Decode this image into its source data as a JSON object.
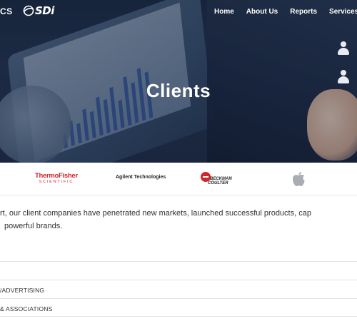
{
  "header": {
    "brand_fragment": "CS",
    "logo_text": "SDi",
    "nav": [
      "Home",
      "About Us",
      "Reports",
      "Services"
    ]
  },
  "hero": {
    "title": "Clients"
  },
  "client_logos": {
    "thermo_line1": "ThermoFisher",
    "thermo_line2": "SCIENTIFIC",
    "agilent": "Agilent Technologies",
    "beckman_line1": "BECKMAN",
    "beckman_line2": "COULTER",
    "apple_icon": "apple-icon"
  },
  "intro": {
    "line1": "rt, our client companies have penetrated new markets, launched successful products, cap",
    "line2": "powerful brands."
  },
  "categories": [
    "",
    "/ADVERTISING",
    "& ASSOCIATIONS"
  ],
  "colors": {
    "accent_red": "#d3262b",
    "hero_dark": "#1a2840"
  }
}
